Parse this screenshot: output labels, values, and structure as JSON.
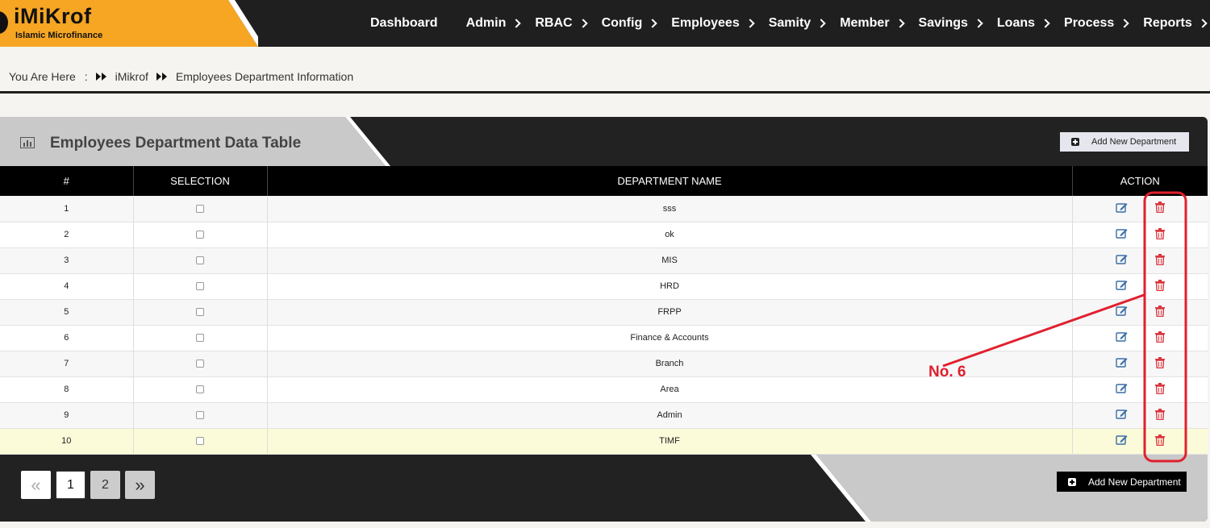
{
  "app": {
    "logo_title": "iMiKrof",
    "logo_subtitle": "Islamic Microfinance",
    "brand_color": "#f6a623"
  },
  "nav": {
    "items": [
      {
        "label": "Dashboard",
        "has_chevron": false
      },
      {
        "label": "Admin",
        "has_chevron": true
      },
      {
        "label": "RBAC",
        "has_chevron": true
      },
      {
        "label": "Config",
        "has_chevron": true
      },
      {
        "label": "Employees",
        "has_chevron": true
      },
      {
        "label": "Samity",
        "has_chevron": true
      },
      {
        "label": "Member",
        "has_chevron": true
      },
      {
        "label": "Savings",
        "has_chevron": true
      },
      {
        "label": "Loans",
        "has_chevron": true
      },
      {
        "label": "Process",
        "has_chevron": true
      },
      {
        "label": "Reports",
        "has_chevron": true
      }
    ]
  },
  "breadcrumb": {
    "prefix": "You Are Here",
    "separator": ":",
    "items": [
      "iMikrof",
      "Employees Department Information"
    ]
  },
  "panel": {
    "title": "Employees Department Data Table",
    "add_button_label": "Add New Department"
  },
  "table": {
    "headers": [
      "#",
      "SELECTION",
      "DEPARTMENT NAME",
      "ACTION"
    ],
    "rows": [
      {
        "num": "1",
        "name": "sss"
      },
      {
        "num": "2",
        "name": "ok"
      },
      {
        "num": "3",
        "name": "MIS"
      },
      {
        "num": "4",
        "name": "HRD"
      },
      {
        "num": "5",
        "name": "FRPP"
      },
      {
        "num": "6",
        "name": "Finance & Accounts"
      },
      {
        "num": "7",
        "name": "Branch"
      },
      {
        "num": "8",
        "name": "Area"
      },
      {
        "num": "9",
        "name": "Admin"
      },
      {
        "num": "10",
        "name": "TIMF"
      }
    ],
    "highlight_row": 10
  },
  "pagination": {
    "prev": "«",
    "pages": [
      "1",
      "2"
    ],
    "current": "1",
    "next": "»"
  },
  "footer": {
    "add_button_label": "Add New Department"
  },
  "annotation": {
    "label": "No. 6",
    "color": "#e0202e"
  }
}
